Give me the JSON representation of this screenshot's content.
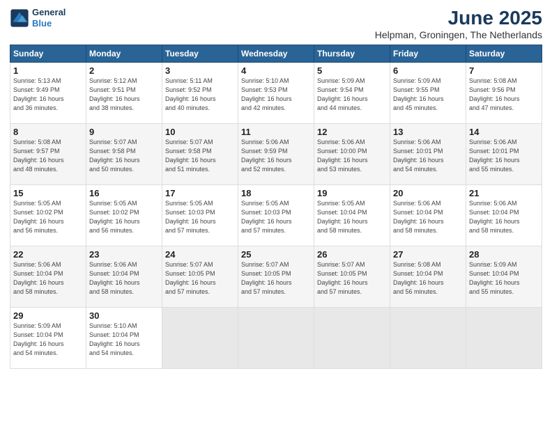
{
  "header": {
    "logo_line1": "General",
    "logo_line2": "Blue",
    "month": "June 2025",
    "location": "Helpman, Groningen, The Netherlands"
  },
  "weekdays": [
    "Sunday",
    "Monday",
    "Tuesday",
    "Wednesday",
    "Thursday",
    "Friday",
    "Saturday"
  ],
  "weeks": [
    [
      {
        "day": 1,
        "info": "Sunrise: 5:13 AM\nSunset: 9:49 PM\nDaylight: 16 hours\nand 36 minutes."
      },
      {
        "day": 2,
        "info": "Sunrise: 5:12 AM\nSunset: 9:51 PM\nDaylight: 16 hours\nand 38 minutes."
      },
      {
        "day": 3,
        "info": "Sunrise: 5:11 AM\nSunset: 9:52 PM\nDaylight: 16 hours\nand 40 minutes."
      },
      {
        "day": 4,
        "info": "Sunrise: 5:10 AM\nSunset: 9:53 PM\nDaylight: 16 hours\nand 42 minutes."
      },
      {
        "day": 5,
        "info": "Sunrise: 5:09 AM\nSunset: 9:54 PM\nDaylight: 16 hours\nand 44 minutes."
      },
      {
        "day": 6,
        "info": "Sunrise: 5:09 AM\nSunset: 9:55 PM\nDaylight: 16 hours\nand 45 minutes."
      },
      {
        "day": 7,
        "info": "Sunrise: 5:08 AM\nSunset: 9:56 PM\nDaylight: 16 hours\nand 47 minutes."
      }
    ],
    [
      {
        "day": 8,
        "info": "Sunrise: 5:08 AM\nSunset: 9:57 PM\nDaylight: 16 hours\nand 48 minutes."
      },
      {
        "day": 9,
        "info": "Sunrise: 5:07 AM\nSunset: 9:58 PM\nDaylight: 16 hours\nand 50 minutes."
      },
      {
        "day": 10,
        "info": "Sunrise: 5:07 AM\nSunset: 9:58 PM\nDaylight: 16 hours\nand 51 minutes."
      },
      {
        "day": 11,
        "info": "Sunrise: 5:06 AM\nSunset: 9:59 PM\nDaylight: 16 hours\nand 52 minutes."
      },
      {
        "day": 12,
        "info": "Sunrise: 5:06 AM\nSunset: 10:00 PM\nDaylight: 16 hours\nand 53 minutes."
      },
      {
        "day": 13,
        "info": "Sunrise: 5:06 AM\nSunset: 10:01 PM\nDaylight: 16 hours\nand 54 minutes."
      },
      {
        "day": 14,
        "info": "Sunrise: 5:06 AM\nSunset: 10:01 PM\nDaylight: 16 hours\nand 55 minutes."
      }
    ],
    [
      {
        "day": 15,
        "info": "Sunrise: 5:05 AM\nSunset: 10:02 PM\nDaylight: 16 hours\nand 56 minutes."
      },
      {
        "day": 16,
        "info": "Sunrise: 5:05 AM\nSunset: 10:02 PM\nDaylight: 16 hours\nand 56 minutes."
      },
      {
        "day": 17,
        "info": "Sunrise: 5:05 AM\nSunset: 10:03 PM\nDaylight: 16 hours\nand 57 minutes."
      },
      {
        "day": 18,
        "info": "Sunrise: 5:05 AM\nSunset: 10:03 PM\nDaylight: 16 hours\nand 57 minutes."
      },
      {
        "day": 19,
        "info": "Sunrise: 5:05 AM\nSunset: 10:04 PM\nDaylight: 16 hours\nand 58 minutes."
      },
      {
        "day": 20,
        "info": "Sunrise: 5:06 AM\nSunset: 10:04 PM\nDaylight: 16 hours\nand 58 minutes."
      },
      {
        "day": 21,
        "info": "Sunrise: 5:06 AM\nSunset: 10:04 PM\nDaylight: 16 hours\nand 58 minutes."
      }
    ],
    [
      {
        "day": 22,
        "info": "Sunrise: 5:06 AM\nSunset: 10:04 PM\nDaylight: 16 hours\nand 58 minutes."
      },
      {
        "day": 23,
        "info": "Sunrise: 5:06 AM\nSunset: 10:04 PM\nDaylight: 16 hours\nand 58 minutes."
      },
      {
        "day": 24,
        "info": "Sunrise: 5:07 AM\nSunset: 10:05 PM\nDaylight: 16 hours\nand 57 minutes."
      },
      {
        "day": 25,
        "info": "Sunrise: 5:07 AM\nSunset: 10:05 PM\nDaylight: 16 hours\nand 57 minutes."
      },
      {
        "day": 26,
        "info": "Sunrise: 5:07 AM\nSunset: 10:05 PM\nDaylight: 16 hours\nand 57 minutes."
      },
      {
        "day": 27,
        "info": "Sunrise: 5:08 AM\nSunset: 10:04 PM\nDaylight: 16 hours\nand 56 minutes."
      },
      {
        "day": 28,
        "info": "Sunrise: 5:09 AM\nSunset: 10:04 PM\nDaylight: 16 hours\nand 55 minutes."
      }
    ],
    [
      {
        "day": 29,
        "info": "Sunrise: 5:09 AM\nSunset: 10:04 PM\nDaylight: 16 hours\nand 54 minutes."
      },
      {
        "day": 30,
        "info": "Sunrise: 5:10 AM\nSunset: 10:04 PM\nDaylight: 16 hours\nand 54 minutes."
      },
      null,
      null,
      null,
      null,
      null
    ]
  ]
}
